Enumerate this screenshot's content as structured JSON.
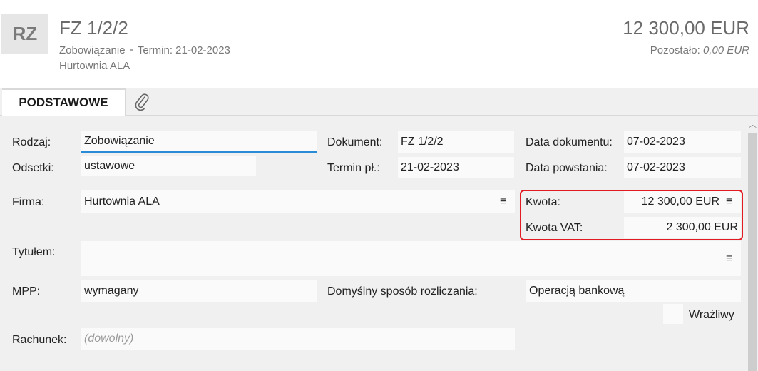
{
  "header": {
    "badge": "RZ",
    "title": "FZ 1/2/2",
    "type": "Zobowiązanie",
    "separator": "•",
    "due": "Termin: 21-02-2023",
    "company": "Hurtownia ALA",
    "amount": "12 300,00 EUR",
    "remaining_label": "Pozostało:",
    "remaining_value": "0,00 EUR"
  },
  "tabs": {
    "active": "PODSTAWOWE",
    "attachment_icon": "paperclip-icon"
  },
  "form": {
    "rodzaj": {
      "label": "Rodzaj:",
      "value": "Zobowiązanie"
    },
    "odsetki": {
      "label": "Odsetki:",
      "value": "ustawowe"
    },
    "dokument": {
      "label": "Dokument:",
      "value": "FZ 1/2/2"
    },
    "termin": {
      "label": "Termin pł.:",
      "value": "21-02-2023"
    },
    "data_dokumentu": {
      "label": "Data dokumentu:",
      "value": "07-02-2023"
    },
    "data_powstania": {
      "label": "Data powstania:",
      "value": "07-02-2023"
    },
    "firma": {
      "label": "Firma:",
      "value": "Hurtownia ALA"
    },
    "kwota": {
      "label": "Kwota:",
      "value": "12 300,00 EUR"
    },
    "kwota_vat": {
      "label": "Kwota VAT:",
      "value": "2 300,00 EUR"
    },
    "tytulem": {
      "label": "Tytułem:",
      "value": ""
    },
    "mpp": {
      "label": "MPP:",
      "value": "wymagany"
    },
    "sposob": {
      "label": "Domyślny sposób rozliczania:",
      "value": "Operacją bankową"
    },
    "wrazliwy": {
      "label": "Wrażliwy",
      "checked": false
    },
    "rachunek": {
      "label": "Rachunek:",
      "placeholder": "(dowolny)"
    },
    "menu_glyph": "≡"
  },
  "colors": {
    "focus_underline": "#2a8bd6",
    "highlight_border": "#e21b22"
  }
}
